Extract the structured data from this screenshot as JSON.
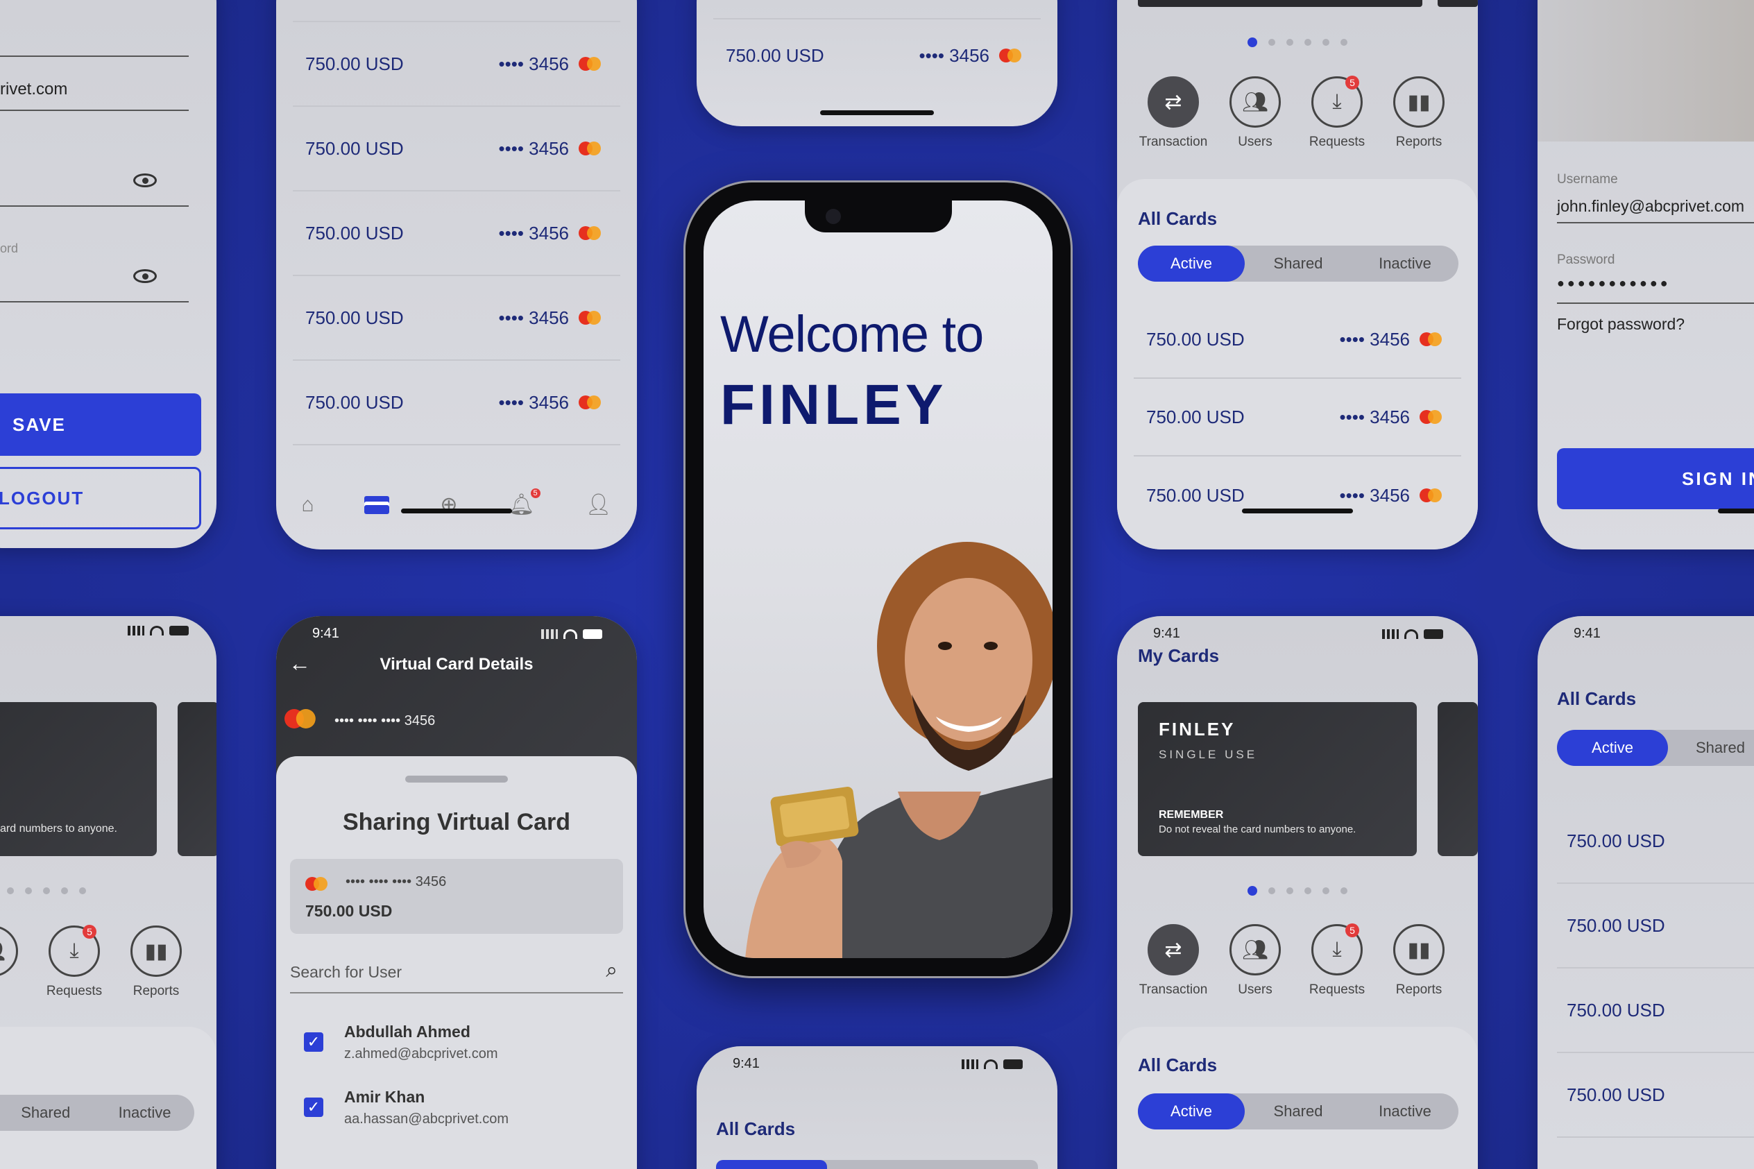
{
  "brand": {
    "welcome": "Welcome to",
    "name": "FINLEY"
  },
  "amount": "750.00 USD",
  "masked": "•••• 3456",
  "status_time": "9:41",
  "profile": {
    "email_fragment": "rivet.com",
    "password_fragment": "ord",
    "save": "SAVE",
    "logout": "LOGOUT"
  },
  "actions": [
    {
      "label": "Transaction",
      "icon": "transfer-icon"
    },
    {
      "label": "Users",
      "icon": "users-icon"
    },
    {
      "label": "Requests",
      "icon": "download-icon",
      "badge": "5"
    },
    {
      "label": "Reports",
      "icon": "bar-chart-icon"
    }
  ],
  "tabs": {
    "active": "Active",
    "shared": "Shared",
    "inactive": "Inactive"
  },
  "all_cards": "All Cards",
  "my_cards": "My Cards",
  "login": {
    "username_label": "Username",
    "username_value": "john.finley@abcprivet.com",
    "password_label": "Password",
    "password_value": "●●●●●●●●●●●",
    "forgot": "Forgot password?",
    "signin": "SIGN IN"
  },
  "virtual_card": {
    "title": "Virtual Card Details",
    "number": "•••• •••• •••• 3456",
    "sharing_title": "Sharing Virtual Card",
    "amount": "750.00 USD",
    "search_placeholder": "Search for User",
    "users": [
      {
        "name": "Abdullah Ahmed",
        "email": "z.ahmed@abcprivet.com"
      },
      {
        "name": "Amir Khan",
        "email": "aa.hassan@abcprivet.com"
      }
    ]
  },
  "finley_card": {
    "brand": "FINLEY",
    "type": "SINGLE USE",
    "remember": "REMEMBER",
    "note": "Do not reveal the card numbers to anyone.",
    "note_fragment": "ard numbers to anyone."
  },
  "nav_badge": "5",
  "colors": {
    "accent": "#2c3fd6",
    "background": "#2030a0",
    "navy": "#1e2a78"
  }
}
